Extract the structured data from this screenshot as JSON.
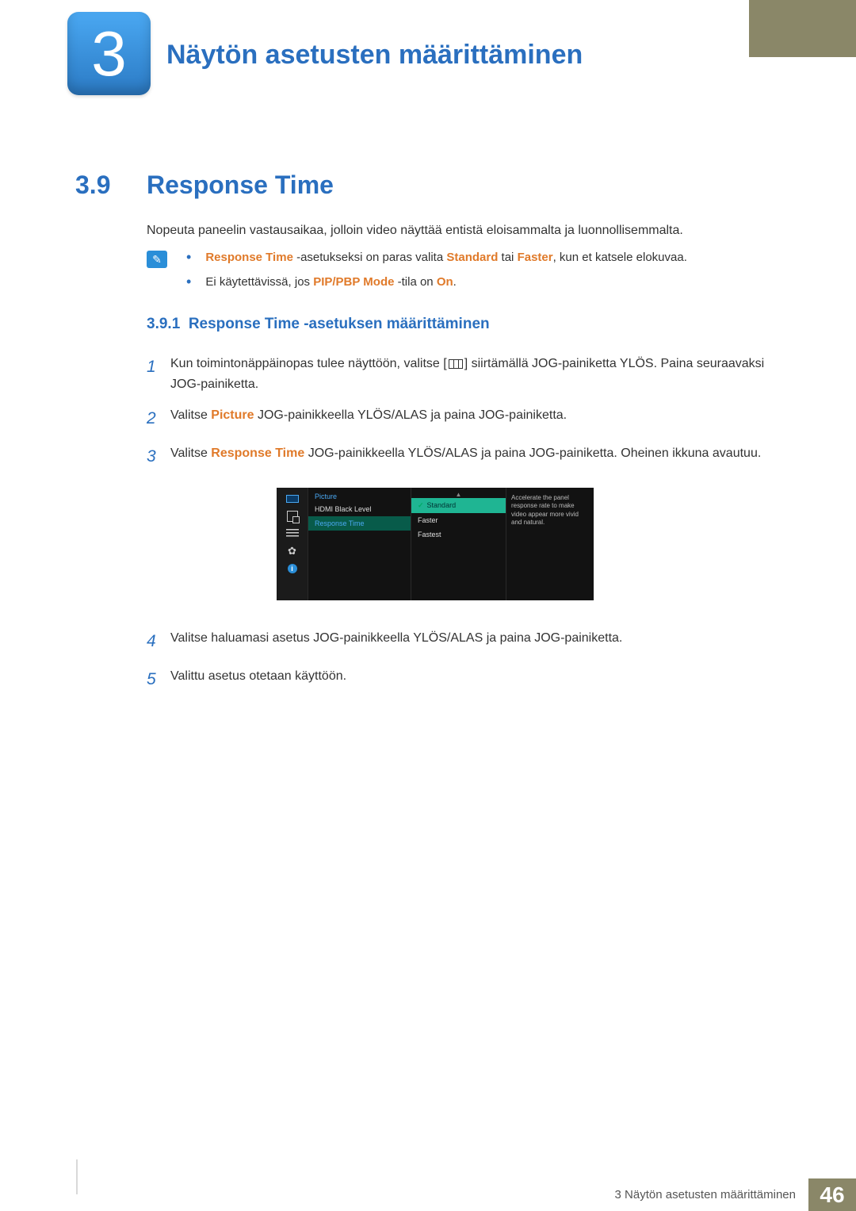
{
  "chapter": {
    "number": "3",
    "title": "Näytön asetusten määrittäminen"
  },
  "section": {
    "number": "3.9",
    "title": "Response Time"
  },
  "intro": "Nopeuta paneelin vastausaikaa, jolloin video näyttää entistä eloisammalta ja luonnollisemmalta.",
  "notes": {
    "item1": {
      "p1": "Response Time",
      "p2": " -asetukseksi on paras valita ",
      "p3": "Standard",
      "p4": " tai ",
      "p5": "Faster",
      "p6": ", kun et katsele elokuvaa."
    },
    "item2": {
      "p1": "Ei käytettävissä, jos ",
      "p2": "PIP/PBP Mode",
      "p3": " -tila on ",
      "p4": "On",
      "p5": "."
    }
  },
  "subsection": {
    "number": "3.9.1",
    "title": "Response Time -asetuksen määrittäminen"
  },
  "steps": {
    "s1": {
      "a": "Kun toimintonäppäinopas tulee näyttöön, valitse [",
      "b": "] siirtämällä JOG-painiketta YLÖS. Paina seuraavaksi JOG-painiketta."
    },
    "s2": {
      "a": "Valitse ",
      "b": "Picture",
      "c": " JOG-painikkeella YLÖS/ALAS ja paina JOG-painiketta."
    },
    "s3": {
      "a": "Valitse ",
      "b": "Response Time",
      "c": " JOG-painikkeella YLÖS/ALAS ja paina JOG-painiketta. Oheinen ikkuna avautuu."
    },
    "s4": "Valitse haluamasi asetus JOG-painikkeella YLÖS/ALAS ja paina JOG-painiketta.",
    "s5": "Valittu asetus otetaan käyttöön."
  },
  "nums": {
    "n1": "1",
    "n2": "2",
    "n3": "3",
    "n4": "4",
    "n5": "5"
  },
  "osd": {
    "header": "Picture",
    "row1": "HDMI Black Level",
    "row2": "Response Time",
    "opt1": "Standard",
    "opt2": "Faster",
    "opt3": "Fastest",
    "arrow": "▲",
    "desc": "Accelerate the panel response rate to make video appear more vivid and natural.",
    "info": "i"
  },
  "footer": {
    "text": "3 Näytön asetusten määrittäminen",
    "page": "46"
  }
}
